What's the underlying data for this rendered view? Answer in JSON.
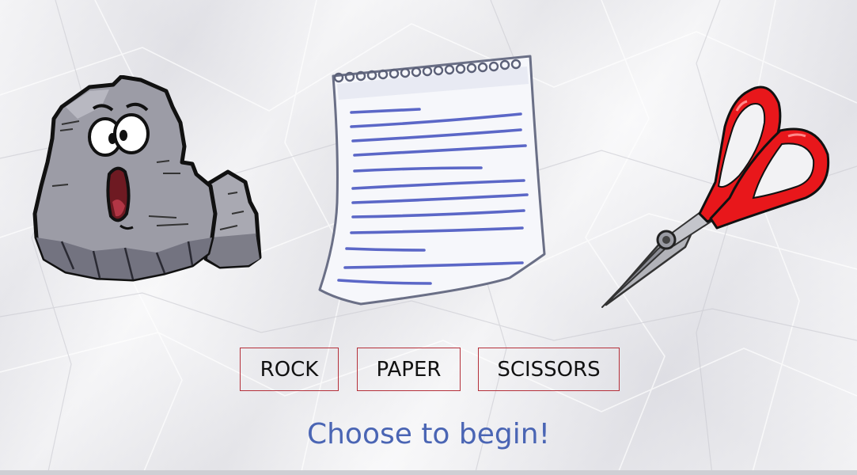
{
  "game": {
    "choices": [
      {
        "id": "rock",
        "label": "ROCK"
      },
      {
        "id": "paper",
        "label": "PAPER"
      },
      {
        "id": "scissors",
        "label": "SCISSORS"
      }
    ],
    "status_message": "Choose to begin!"
  },
  "colors": {
    "status_text": "#4a65b4",
    "button_border": "#b5303a",
    "scissors_handle": "#e8171b",
    "paper_lines": "#5b67c7",
    "rock_fill": "#9c9ca6"
  },
  "icons": [
    "rock-character-icon",
    "paper-sheet-icon",
    "scissors-icon"
  ]
}
